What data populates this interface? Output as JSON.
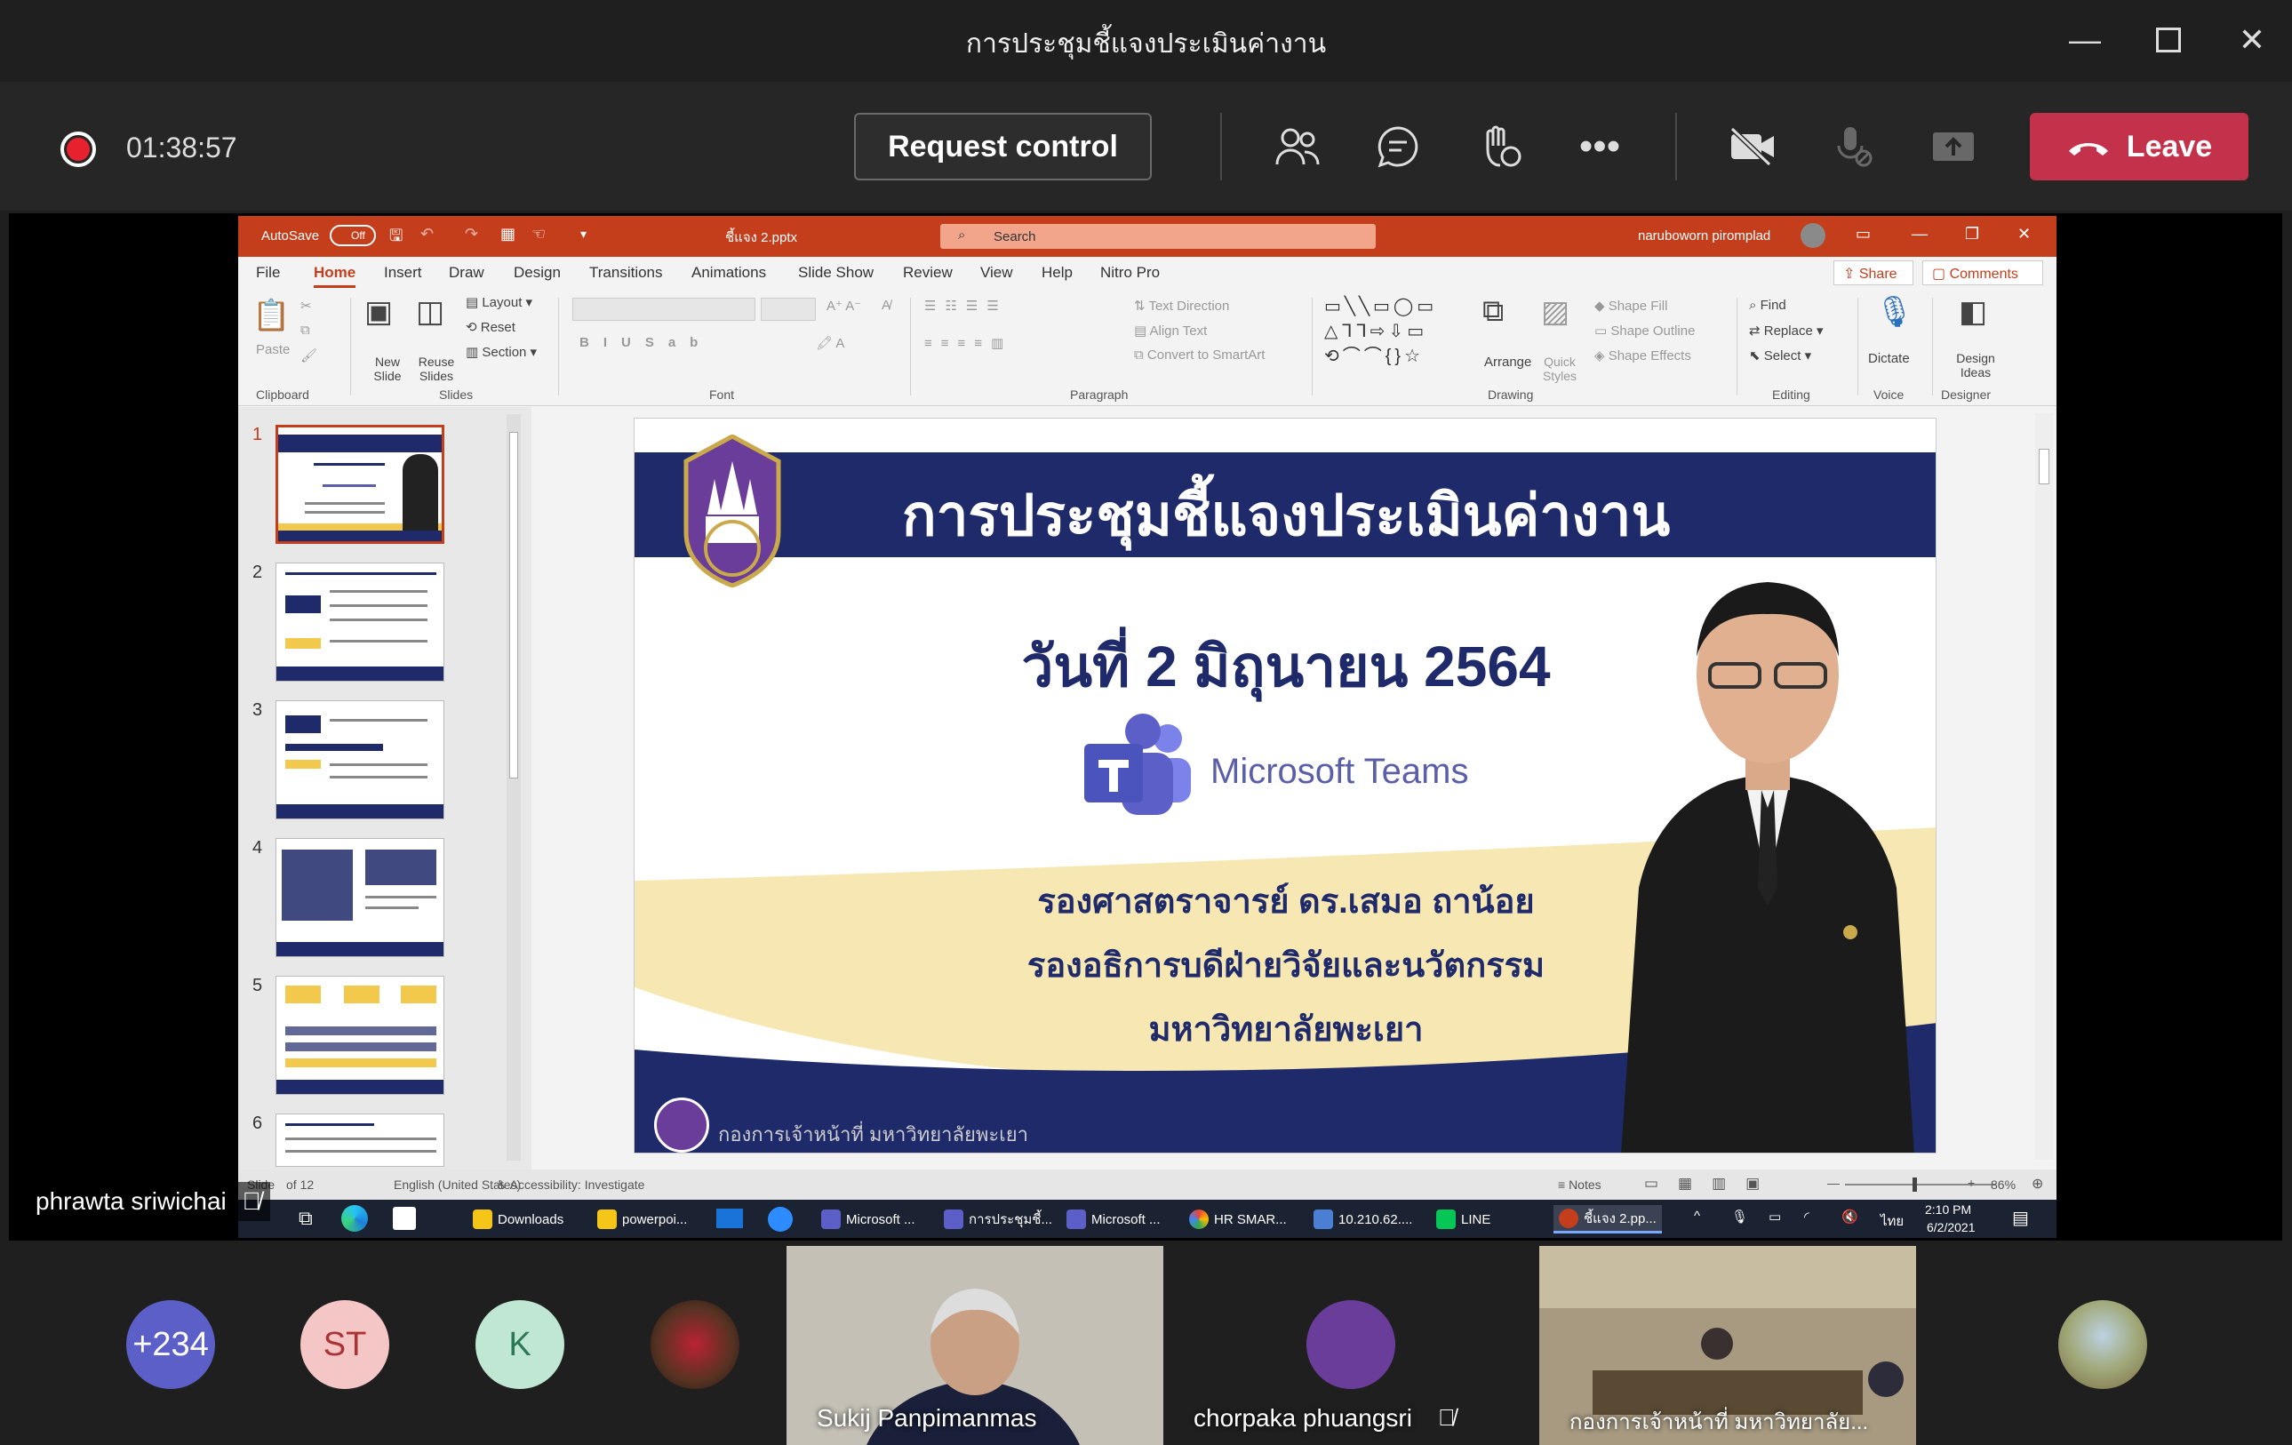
{
  "window": {
    "title": "การประชุมชี้แจงประเมินค่างาน"
  },
  "callbar": {
    "timer": "01:38:57",
    "request_control": "Request control",
    "leave": "Leave"
  },
  "ppt": {
    "autosave": "AutoSave",
    "autosave_state": "Off",
    "file_name": "ชี้แจง 2.pptx",
    "search_placeholder": "Search",
    "user_name": "naruboworn piromplad",
    "share": "Share",
    "comments": "Comments",
    "tabs": [
      "File",
      "Home",
      "Insert",
      "Draw",
      "Design",
      "Transitions",
      "Animations",
      "Slide Show",
      "Review",
      "View",
      "Help",
      "Nitro Pro"
    ],
    "ribbon": {
      "clipboard": {
        "paste": "Paste",
        "label": "Clipboard"
      },
      "slides": {
        "new_slide": "New Slide",
        "reuse": "Reuse Slides",
        "layout": "Layout",
        "reset": "Reset",
        "section": "Section",
        "label": "Slides"
      },
      "font": {
        "label": "Font"
      },
      "paragraph": {
        "text_direction": "Text Direction",
        "align_text": "Align Text",
        "smartart": "Convert to SmartArt",
        "label": "Paragraph"
      },
      "drawing": {
        "arrange": "Arrange",
        "quick_styles": "Quick Styles",
        "shape_fill": "Shape Fill",
        "shape_outline": "Shape Outline",
        "shape_effects": "Shape Effects",
        "label": "Drawing"
      },
      "editing": {
        "find": "Find",
        "replace": "Replace",
        "select": "Select",
        "label": "Editing"
      },
      "voice": {
        "dictate": "Dictate",
        "label": "Voice"
      },
      "designer": {
        "design_ideas": "Design Ideas",
        "label": "Designer"
      }
    },
    "thumb_numbers": [
      "1",
      "2",
      "3",
      "4",
      "5",
      "6"
    ],
    "slide": {
      "title": "การประชุมชี้แจงประเมินค่างาน",
      "date": "วันที่ 2 มิถุนายน 2564",
      "teams": "Microsoft Teams",
      "role1": "รองศาสตราจารย์ ดร.เสมอ ถาน้อย",
      "role2": "รองอธิการบดีฝ่ายวิจัยและนวัตกรรม",
      "role3": "มหาวิทยาลัยพะเยา",
      "footer": "กองการเจ้าหน้าที่ มหาวิทยาลัยพะเยา"
    },
    "status": {
      "slide": "Slide",
      "of": "of 12",
      "language": "English (United States)",
      "accessibility": "Accessibility: Investigate",
      "notes": "Notes",
      "zoom": "86%"
    },
    "taskbar": {
      "items": [
        "Downloads",
        "powerpoi...",
        "Microsoft ...",
        "การประชุมชี้...",
        "Microsoft ...",
        "HR SMAR...",
        "10.210.62....",
        "LINE",
        "ชี้แจง 2.pp..."
      ],
      "lang": "ไทย",
      "time": "2:10 PM",
      "date": "6/2/2021"
    }
  },
  "presenter": "phrawta sriwichai",
  "participants": {
    "overflow": "+234",
    "st": "ST",
    "k": "K",
    "p1": "Sukij Panpimanmas",
    "p2": "chorpaka phuangsri",
    "p3": "กองการเจ้าหน้าที่ มหาวิทยาลัย..."
  },
  "colors": {
    "leave": "#c4314b",
    "ppt_accent": "#c43e1c",
    "slide_navy": "#1f2a6b",
    "gold": "#f2c94c"
  }
}
